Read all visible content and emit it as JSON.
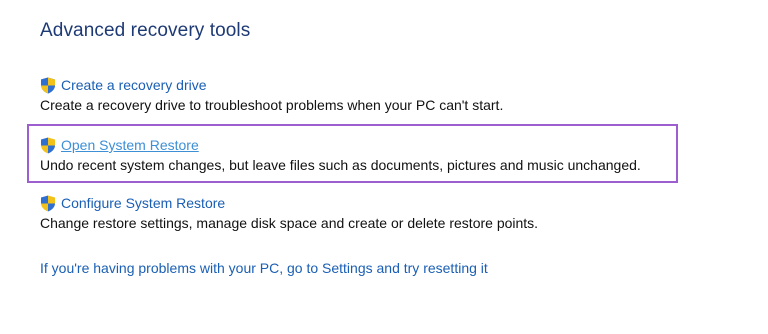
{
  "section": {
    "title": "Advanced recovery tools"
  },
  "tools": [
    {
      "link": "Create a recovery drive",
      "description": "Create a recovery drive to troubleshoot problems when your PC can't start.",
      "icon": "uac-shield-icon"
    },
    {
      "link": "Open System Restore",
      "description": "Undo recent system changes, but leave files such as documents, pictures and music unchanged.",
      "icon": "uac-shield-icon",
      "highlighted": true
    },
    {
      "link": "Configure System Restore",
      "description": "Change restore settings, manage disk space and create or delete restore points.",
      "icon": "uac-shield-icon"
    }
  ],
  "footer": {
    "reset_link": "If you're having problems with your PC, go to Settings and try resetting it"
  },
  "colors": {
    "title": "#1e3a75",
    "link": "#1a5fb4",
    "active_link": "#3d8fd6",
    "highlight_border": "#9d5fd0"
  }
}
